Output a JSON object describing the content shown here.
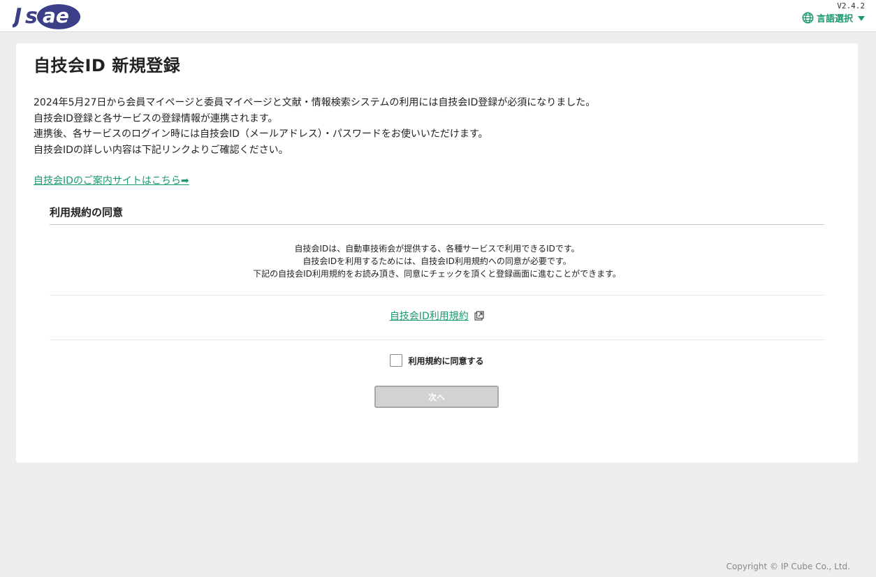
{
  "header": {
    "logo_text": "JSAE",
    "version": "V2.4.2",
    "language_label": "言語選択",
    "brand_color": "#1a9a6c"
  },
  "main": {
    "title": "自技会ID 新規登録",
    "intro_lines": [
      "2024年5月27日から会員マイページと委員マイページと文献・情報検索システムの利用には自技会ID登録が必須になりました。",
      "自技会ID登録と各サービスの登録情報が連携されます。",
      "連携後、各サービスのログイン時には自技会ID（メールアドレス）・パスワードをお使いいただけます。",
      "自技会IDの詳しい内容は下記リンクよりご確認ください。"
    ],
    "guide_link": "自技会IDのご案内サイトはこちら➡"
  },
  "terms": {
    "section_title": "利用規約の同意",
    "description_lines": [
      "自技会IDは、自動車技術会が提供する、各種サービスで利用できるIDです。",
      "自技会IDを利用するためには、自技会ID利用規約への同意が必要です。",
      "下記の自技会ID利用規約をお読み頂き、同意にチェックを頂くと登録画面に進むことができます。"
    ],
    "terms_link": "自技会ID利用規約",
    "agree_label": "利用規約に同意する",
    "agree_checked": false,
    "next_button": "次へ",
    "next_enabled": false
  },
  "footer": {
    "copyright": "Copyright © IP Cube Co., Ltd."
  }
}
